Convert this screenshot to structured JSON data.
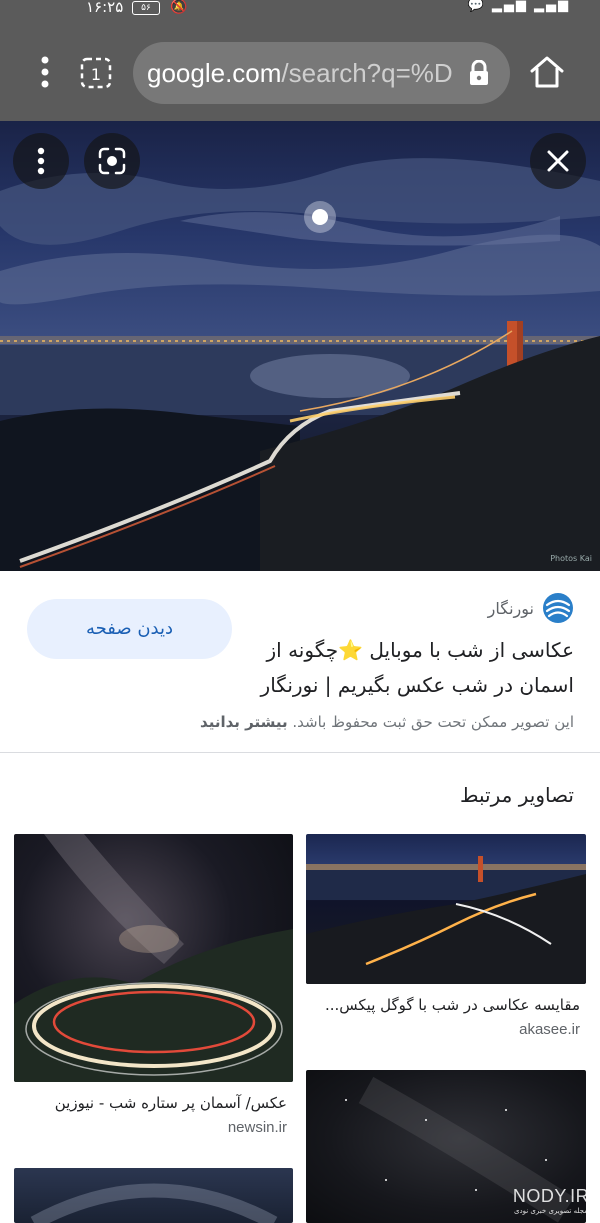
{
  "status_bar": {
    "time": "۱۶:۲۵",
    "battery": "۵۶"
  },
  "browser": {
    "url_host": "google.com",
    "url_path": "/search?q=%D",
    "icons": [
      "more-vert-icon",
      "tab-switcher-icon",
      "lock-icon",
      "home-icon"
    ]
  },
  "viewer": {
    "icons": [
      "more-vert-icon",
      "google-lens-icon",
      "close-icon"
    ],
    "image_credit": "Photos Kai"
  },
  "result": {
    "source_name": "نورنگار",
    "visit_button": "دیدن صفحه",
    "title_line1": "عکاسی از شب با موبایل ⭐چگونه از",
    "title_line2": "اسمان در شب عکس بگیریم | نورنگار",
    "copyright_text": "این تصویر ممکن تحت حق ثبت محفوظ باشد.",
    "learn_more": "بیشتر بدانید",
    "accent_color": "#1a5fb4"
  },
  "related": {
    "heading": "تصاویر مرتبط",
    "items": [
      {
        "title": "مقایسه عکاسی در شب با گوگل پیکس...",
        "domain": "akasee.ir"
      },
      {
        "title": "عکس/ آسمان پر ستاره شب - نیوزین",
        "domain": "newsin.ir"
      }
    ]
  },
  "watermark": {
    "brand": "NODY.IR",
    "tagline": "مجله تصویری خبری نودی"
  }
}
